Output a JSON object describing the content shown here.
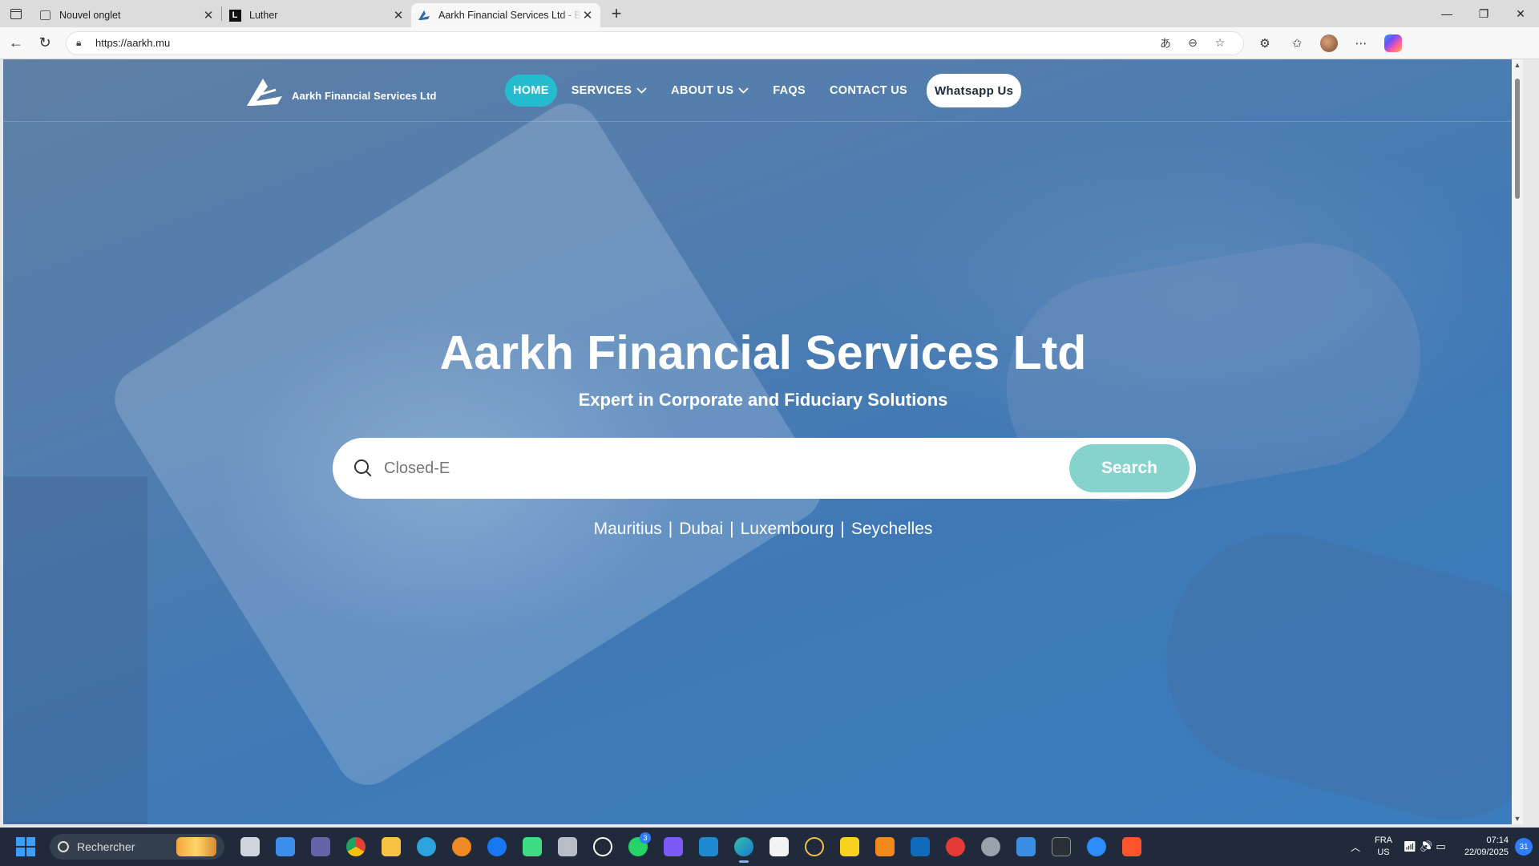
{
  "browser": {
    "tabs": [
      {
        "title": "Nouvel onglet",
        "active": false
      },
      {
        "title": "Luther",
        "favicon_letter": "L",
        "active": false
      },
      {
        "title": "Aarkh Financial Services Ltd - Best",
        "active": true
      }
    ],
    "url": "https://aarkh.mu"
  },
  "site": {
    "logo_text": "Aarkh Financial Services Ltd",
    "nav": {
      "home": "HOME",
      "services": "SERVICES",
      "about": "ABOUT US",
      "faqs": "FAQS",
      "contact": "CONTACT US",
      "whatsapp": "Whatsapp Us"
    },
    "hero": {
      "title": "Aarkh Financial Services Ltd",
      "subtitle": "Expert in Corporate and Fiduciary Solutions",
      "search_value": "Closed-E",
      "search_button": "Search",
      "locations": [
        "Mauritius",
        "Dubai",
        "Luxembourg",
        "Seychelles"
      ],
      "separator": "|"
    }
  },
  "taskbar": {
    "search_placeholder": "Rechercher",
    "whatsapp_badge": "3",
    "lang_line1": "FRA",
    "lang_line2": "US",
    "time": "07:14",
    "date": "22/09/2025",
    "notifications": "31"
  },
  "colors": {
    "accent": "#26bcd0",
    "search_button": "#85d3cb"
  }
}
